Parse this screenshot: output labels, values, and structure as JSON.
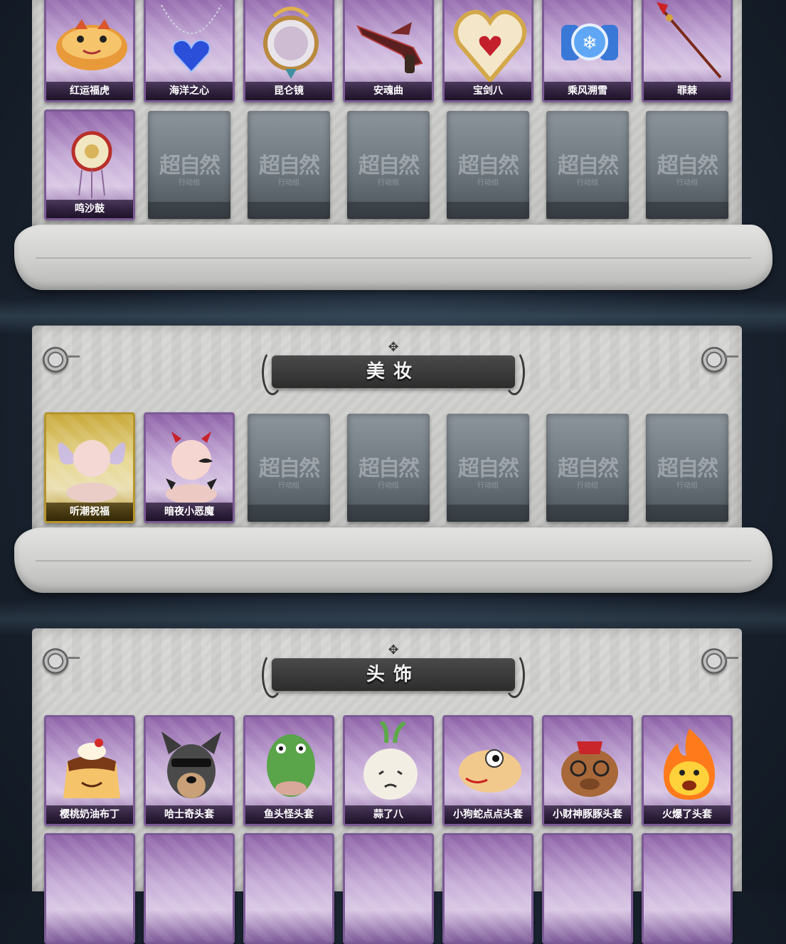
{
  "watermark": {
    "main": "超自然",
    "sub": "行动组"
  },
  "sections": [
    {
      "id": "weapons",
      "title": "",
      "cards": [
        {
          "label": "红运福虎",
          "icon": "tiger-plush-icon",
          "frame": "purple"
        },
        {
          "label": "海洋之心",
          "icon": "heart-necklace-icon",
          "frame": "purple"
        },
        {
          "label": "昆仑镜",
          "icon": "ornate-mirror-icon",
          "frame": "purple"
        },
        {
          "label": "安魂曲",
          "icon": "winged-pistol-icon",
          "frame": "purple"
        },
        {
          "label": "宝剑八",
          "icon": "heart-shield-icon",
          "frame": "purple"
        },
        {
          "label": "乘风溯雪",
          "icon": "snow-lantern-icon",
          "frame": "purple"
        },
        {
          "label": "罪棘",
          "icon": "spear-icon",
          "frame": "purple"
        },
        {
          "label": "鸣沙鼓",
          "icon": "dreamcatcher-drum-icon",
          "frame": "purple"
        }
      ],
      "empty_slots": 6
    },
    {
      "id": "makeup",
      "title": "美妆",
      "cards": [
        {
          "label": "听潮祝福",
          "icon": "fairy-wings-head-icon",
          "frame": "gold"
        },
        {
          "label": "暗夜小恶魔",
          "icon": "devil-horns-head-icon",
          "frame": "purple"
        }
      ],
      "empty_slots": 5
    },
    {
      "id": "headwear",
      "title": "头饰",
      "cards": [
        {
          "label": "樱桃奶油布丁",
          "icon": "pudding-head-icon",
          "frame": "purple"
        },
        {
          "label": "哈士奇头套",
          "icon": "husky-head-icon",
          "frame": "purple"
        },
        {
          "label": "鱼头怪头套",
          "icon": "fish-head-icon",
          "frame": "purple"
        },
        {
          "label": "蒜了八",
          "icon": "garlic-head-icon",
          "frame": "purple"
        },
        {
          "label": "小狗蛇点点头套",
          "icon": "snake-head-icon",
          "frame": "purple"
        },
        {
          "label": "小财神豚豚头套",
          "icon": "capybara-head-icon",
          "frame": "purple"
        },
        {
          "label": "火爆了头套",
          "icon": "fire-head-icon",
          "frame": "purple"
        }
      ]
    }
  ]
}
